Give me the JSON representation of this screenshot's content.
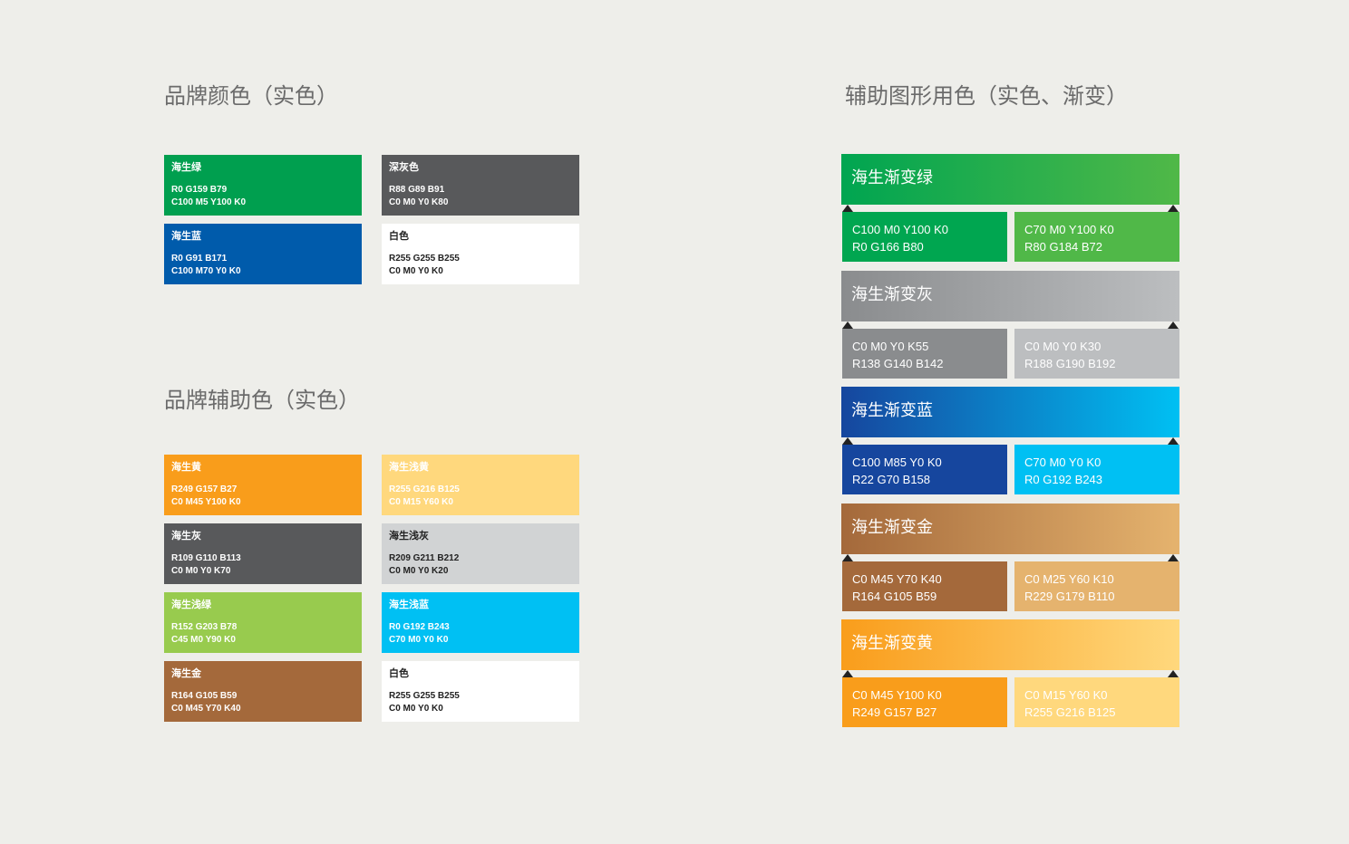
{
  "headings": {
    "brand": "品牌颜色（实色）",
    "brand_aux": "品牌辅助色（实色）",
    "graphic": "辅助图形用色（实色、渐变）"
  },
  "brand_colors": [
    {
      "name": "海生绿",
      "line1": "R0 G159 B79",
      "line2": "C100 M5 Y100 K0",
      "bg": "#009f4f",
      "text": "#ffffff"
    },
    {
      "name": "深灰色",
      "line1": "R88 G89 B91",
      "line2": "C0 M0 Y0 K80",
      "bg": "#58595b",
      "text": "#ffffff"
    },
    {
      "name": "海生蓝",
      "line1": "R0 G91 B171",
      "line2": "C100 M70 Y0 K0",
      "bg": "#005bab",
      "text": "#ffffff"
    },
    {
      "name": "白色",
      "line1": "R255 G255 B255",
      "line2": "C0 M0 Y0 K0",
      "bg": "#ffffff",
      "text": "#222222"
    }
  ],
  "aux_colors": [
    {
      "name": "海生黄",
      "line1": "R249 G157 B27",
      "line2": "C0 M45 Y100 K0",
      "bg": "#f99d1b",
      "text": "#ffffff"
    },
    {
      "name": "海生浅黄",
      "line1": "R255 G216 B125",
      "line2": "C0 M15 Y60 K0",
      "bg": "#ffd87d",
      "text": "#ffffff"
    },
    {
      "name": "海生灰",
      "line1": "R109 G110 B113",
      "line2": "C0 M0 Y0 K70",
      "bg": "#58595b",
      "text": "#ffffff"
    },
    {
      "name": "海生浅灰",
      "line1": "R209 G211 B212",
      "line2": "C0 M0 Y0 K20",
      "bg": "#d1d3d4",
      "text": "#222222"
    },
    {
      "name": "海生浅绿",
      "line1": "R152 G203 B78",
      "line2": "C45 M0 Y90 K0",
      "bg": "#98cb4e",
      "text": "#ffffff"
    },
    {
      "name": "海生浅蓝",
      "line1": "R0 G192 B243",
      "line2": "C70 M0 Y0 K0",
      "bg": "#00c0f3",
      "text": "#ffffff"
    },
    {
      "name": "海生金",
      "line1": "R164 G105 B59",
      "line2": "C0 M45 Y70 K40",
      "bg": "#a4693b",
      "text": "#ffffff"
    },
    {
      "name": "白色",
      "line1": "R255 G255 B255",
      "line2": "C0 M0 Y0 K0",
      "bg": "#ffffff",
      "text": "#222222"
    }
  ],
  "gradients": [
    {
      "title": "海生渐变绿",
      "from": "#00a551",
      "to": "#50b848",
      "title_color": "#ffffff",
      "left": {
        "line1": "C100 M0 Y100 K0",
        "line2": "R0 G166 B80",
        "bg": "#00a650",
        "text": "#ffffff"
      },
      "right": {
        "line1": "C70 M0 Y100 K0",
        "line2": "R80 G184 B72",
        "bg": "#50b848",
        "text": "#ffffff"
      }
    },
    {
      "title": "海生渐变灰",
      "from": "#8a8c8e",
      "to": "#bcbec0",
      "title_color": "#ffffff",
      "left": {
        "line1": "C0 M0 Y0 K55",
        "line2": "R138 G140 B142",
        "bg": "#8a8c8e",
        "text": "#ffffff"
      },
      "right": {
        "line1": "C0 M0 Y0 K30",
        "line2": "R188 G190 B192",
        "bg": "#bcbec0",
        "text": "#ffffff"
      }
    },
    {
      "title": "海生渐变蓝",
      "from": "#16469e",
      "to": "#00c0f3",
      "title_color": "#ffffff",
      "left": {
        "line1": "C100 M85 Y0 K0",
        "line2": "R22 G70 B158",
        "bg": "#16469e",
        "text": "#ffffff"
      },
      "right": {
        "line1": "C70 M0 Y0 K0",
        "line2": "R0 G192 B243",
        "bg": "#00c0f3",
        "text": "#ffffff"
      }
    },
    {
      "title": "海生渐变金",
      "from": "#a4693b",
      "to": "#e5b36e",
      "title_color": "#ffffff",
      "left": {
        "line1": "C0 M45 Y70 K40",
        "line2": "R164 G105 B59",
        "bg": "#a4693b",
        "text": "#ffffff"
      },
      "right": {
        "line1": "C0 M25 Y60 K10",
        "line2": "R229 G179 B110",
        "bg": "#e5b36e",
        "text": "#ffffff"
      }
    },
    {
      "title": "海生渐变黄",
      "from": "#f99d1b",
      "to": "#ffd87d",
      "title_color": "#ffffff",
      "left": {
        "line1": "C0 M45 Y100 K0",
        "line2": "R249 G157 B27",
        "bg": "#f99d1b",
        "text": "#ffffff"
      },
      "right": {
        "line1": "C0 M15 Y60 K0",
        "line2": "R255 G216 B125",
        "bg": "#ffd87d",
        "text": "#ffffff"
      }
    }
  ]
}
